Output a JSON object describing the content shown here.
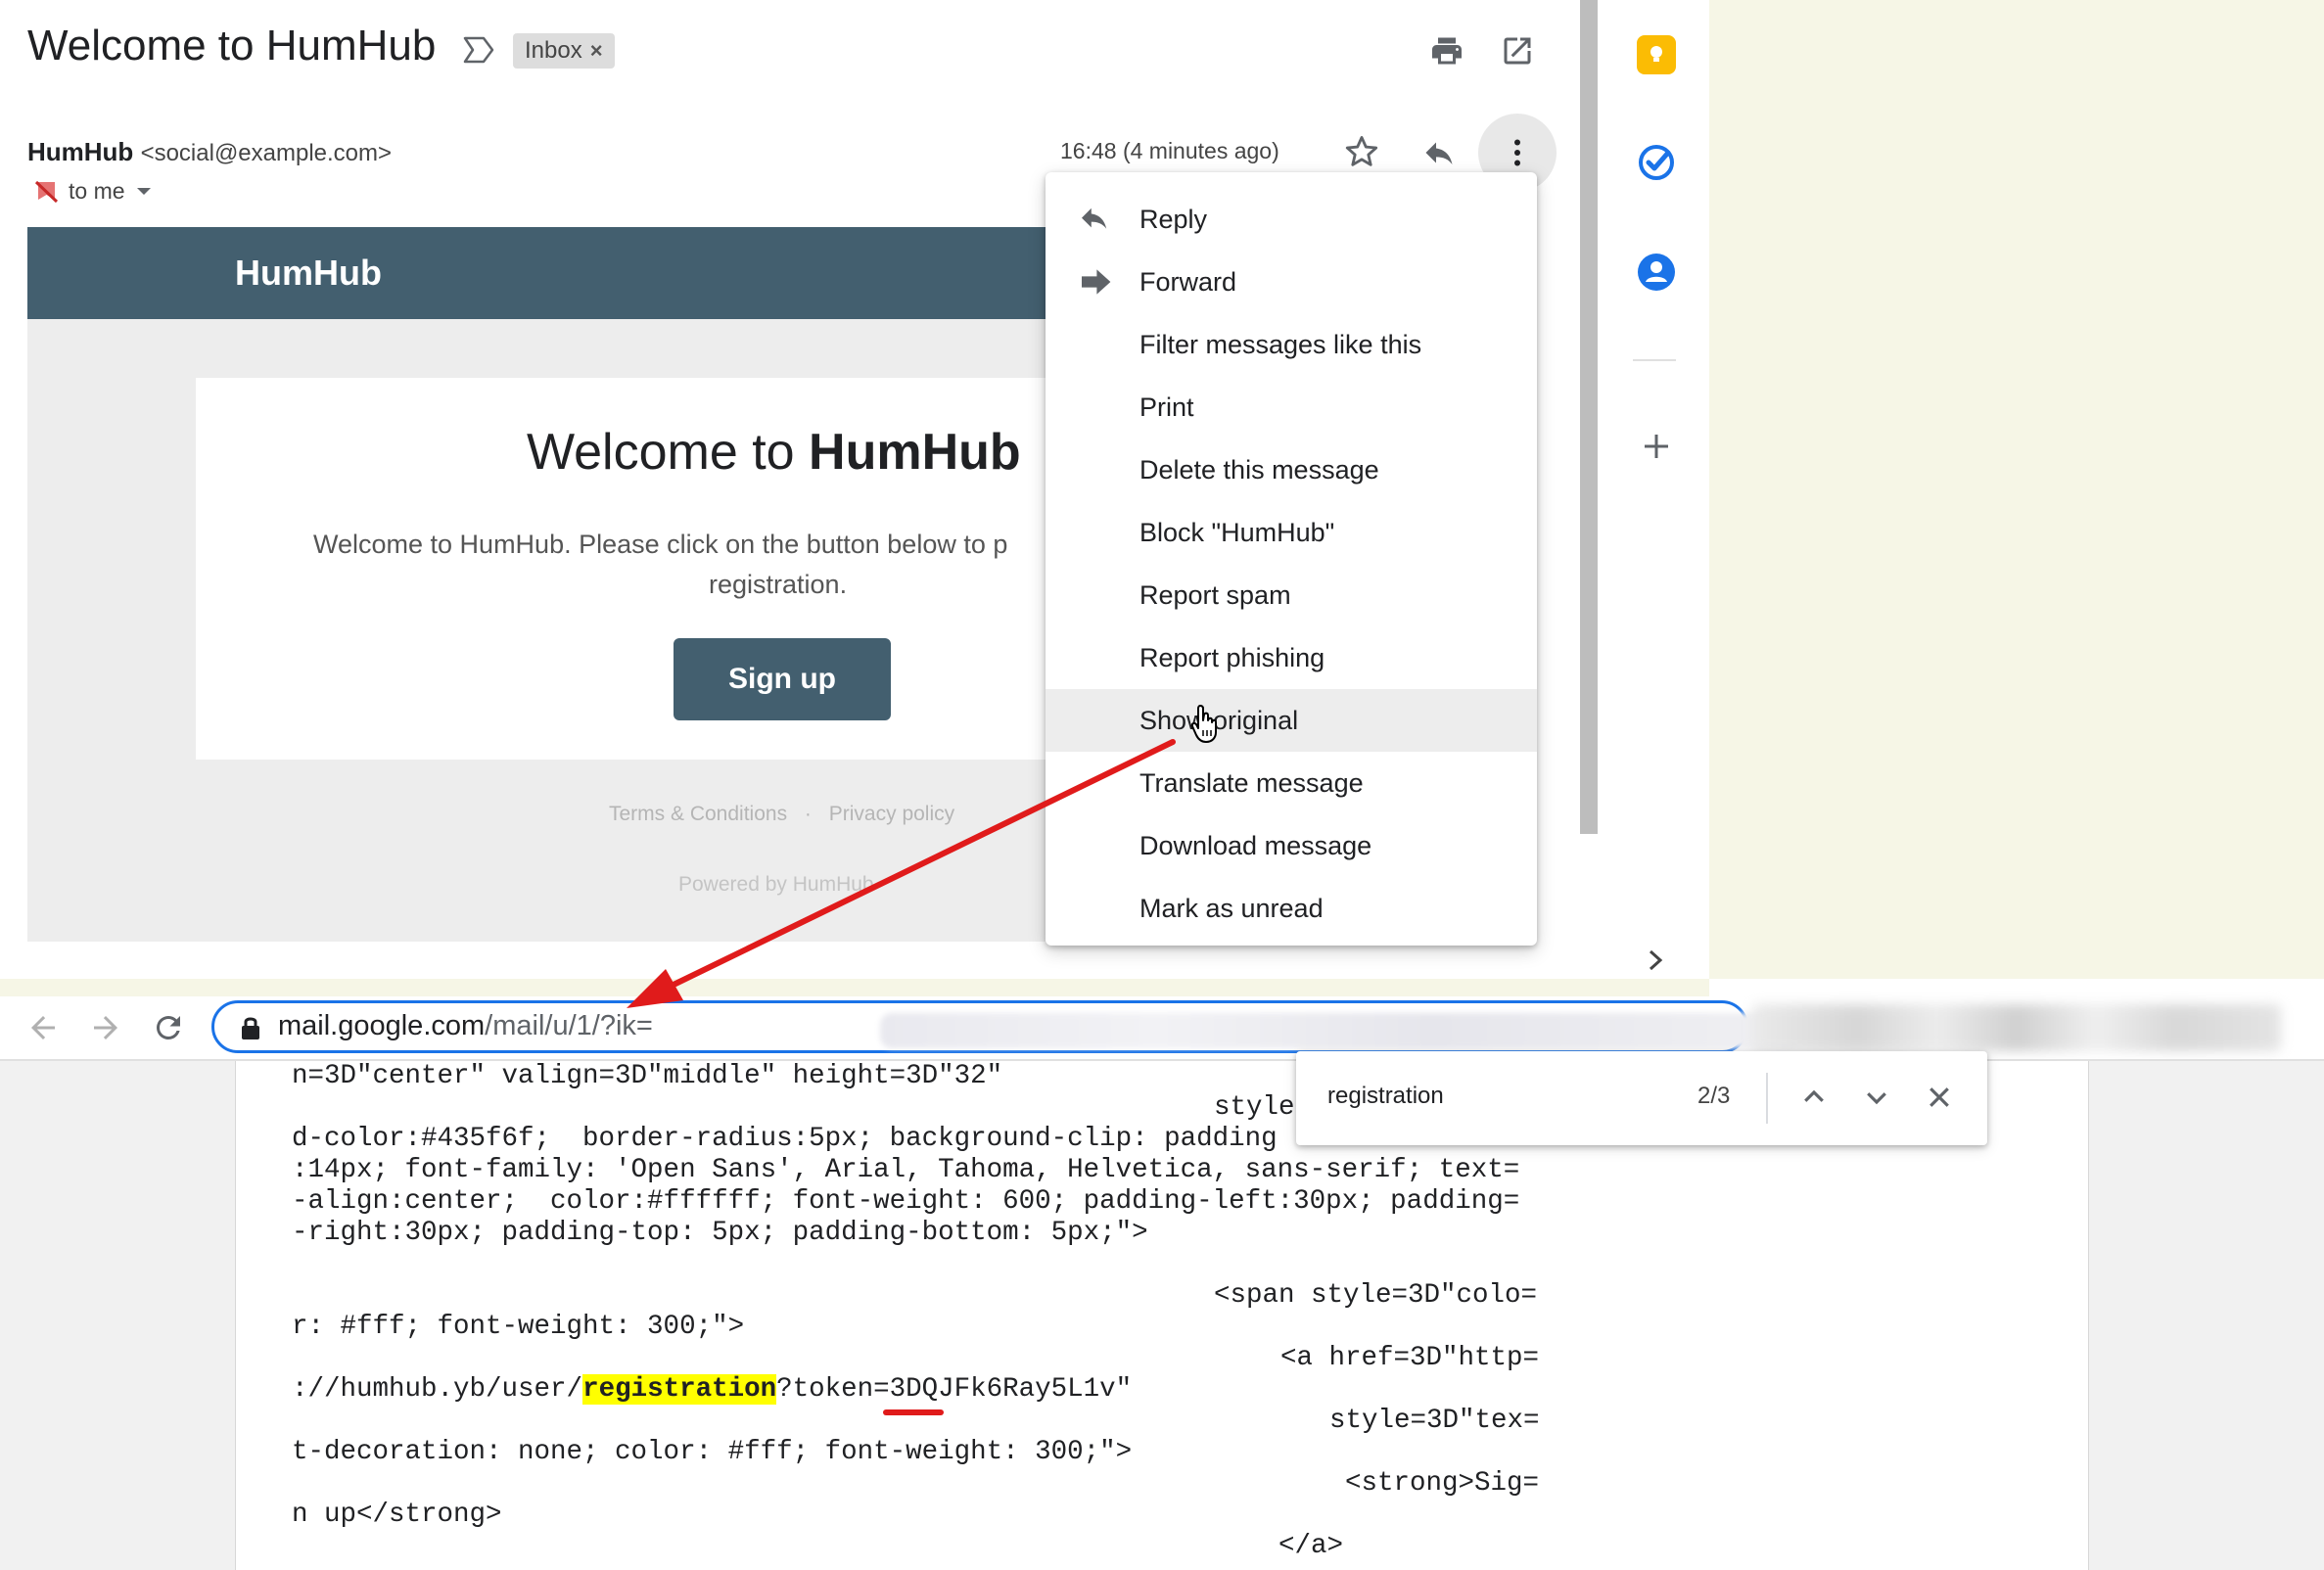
{
  "email": {
    "subject": "Welcome to HumHub",
    "label": "Inbox",
    "label_close": "×",
    "sender_name": "HumHub",
    "sender_email": "<social@example.com>",
    "recipient": "to me",
    "time": "16:48 (4 minutes ago)",
    "icons": [
      "important-icon",
      "print-icon",
      "open-new-window-icon",
      "star-icon",
      "reply-icon",
      "more-vert-icon"
    ]
  },
  "body": {
    "banner_title": "HumHub",
    "card_title_prefix": "Welcome to ",
    "card_title_bold": "HumHub",
    "card_text_line1": "Welcome to HumHub. Please click on the button below to p",
    "card_text_line2": "registration.",
    "signup_label": "Sign up",
    "footer_terms": "Terms & Conditions",
    "footer_dot": "·",
    "footer_privacy": "Privacy policy",
    "powered_by": "Powered by HumHub"
  },
  "menu": {
    "items": [
      {
        "label": "Reply",
        "icon": "reply-icon"
      },
      {
        "label": "Forward",
        "icon": "forward-icon"
      },
      {
        "label": "Filter messages like this"
      },
      {
        "label": "Print"
      },
      {
        "label": "Delete this message"
      },
      {
        "label": "Block \"HumHub\""
      },
      {
        "label": "Report spam"
      },
      {
        "label": "Report phishing"
      },
      {
        "label": "Show original",
        "highlighted": true
      },
      {
        "label": "Translate message"
      },
      {
        "label": "Download message"
      },
      {
        "label": "Mark as unread"
      }
    ]
  },
  "browser": {
    "url_host": "mail.google.com",
    "url_path": "/mail/u/1/?ik="
  },
  "find_bar": {
    "query": "registration",
    "count": "2/3"
  },
  "source": {
    "lines_left": [
      "n=3D\"center\" valign=3D\"middle\" height=3D\"32\"",
      "d-color:#435f6f;  border-radius:5px; background-clip: padding",
      ":14px; font-family: 'Open Sans', Arial, Tahoma, Helvetica, sans-serif; text=",
      "-align:center;  color:#ffffff; font-weight: 600; padding-left:30px; padding=",
      "-right:30px; padding-top: 5px; padding-bottom: 5px;\">",
      "r: #fff; font-weight: 300;\">",
      "t-decoration: none; color: #fff; font-weight: 300;\">",
      "n up</strong>"
    ],
    "link_prefix": "://humhub.yb/user/",
    "link_match": "registration",
    "link_suffix": "?token=3DQJFk6Ray5L1v\"",
    "lines_right": [
      "style",
      "<span style=3D\"colo=",
      "<a href=3D\"http=",
      "style=3D\"tex=",
      "<strong>Sig=",
      "</a>"
    ]
  },
  "colors": {
    "brand": "#435f6f",
    "accent_blue": "#1a73e8",
    "annotation_red": "#e01b1b",
    "highlight": "#ffff00"
  }
}
